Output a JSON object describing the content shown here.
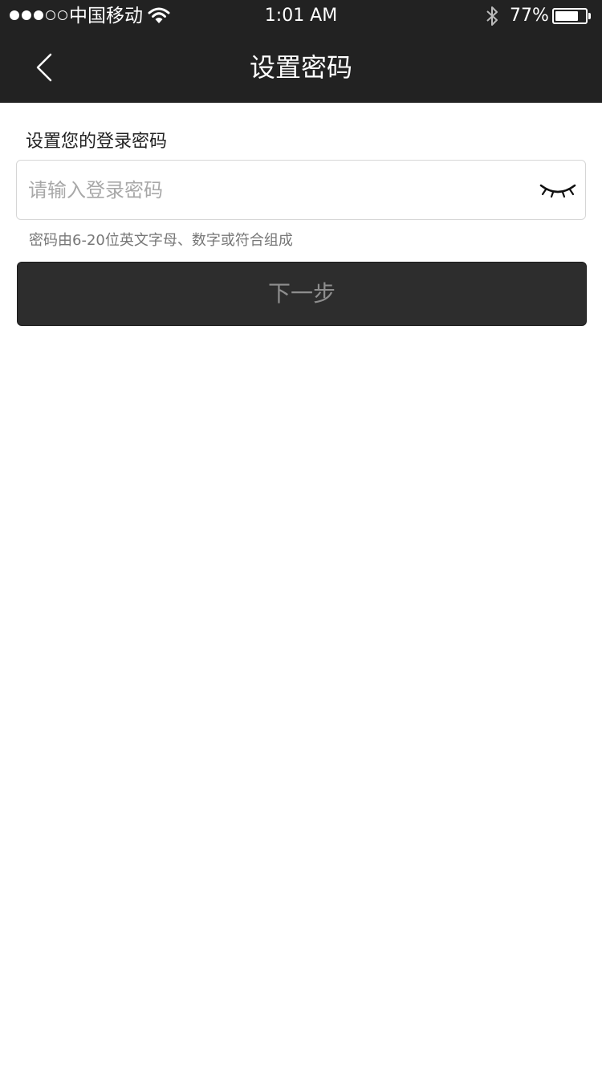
{
  "status_bar": {
    "carrier": "中国移动",
    "time": "1:01 AM",
    "battery_percent": "77%",
    "battery_level": 0.77,
    "signal_strength": 3,
    "signal_max": 5,
    "icons": [
      "wifi-icon",
      "bluetooth-icon",
      "battery-icon"
    ]
  },
  "nav": {
    "title": "设置密码",
    "back_icon": "chevron-left-icon"
  },
  "form": {
    "label": "设置您的登录密码",
    "password_placeholder": "请输入登录密码",
    "password_value": "",
    "visibility_icon": "eye-closed-icon",
    "hint": "密码由6-20位英文字母、数字或符合组成",
    "next_button": "下一步"
  },
  "colors": {
    "header_bg": "#222222",
    "button_bg": "#2d2d2d",
    "button_text": "#8e8e8e",
    "hint_text": "#777777"
  }
}
